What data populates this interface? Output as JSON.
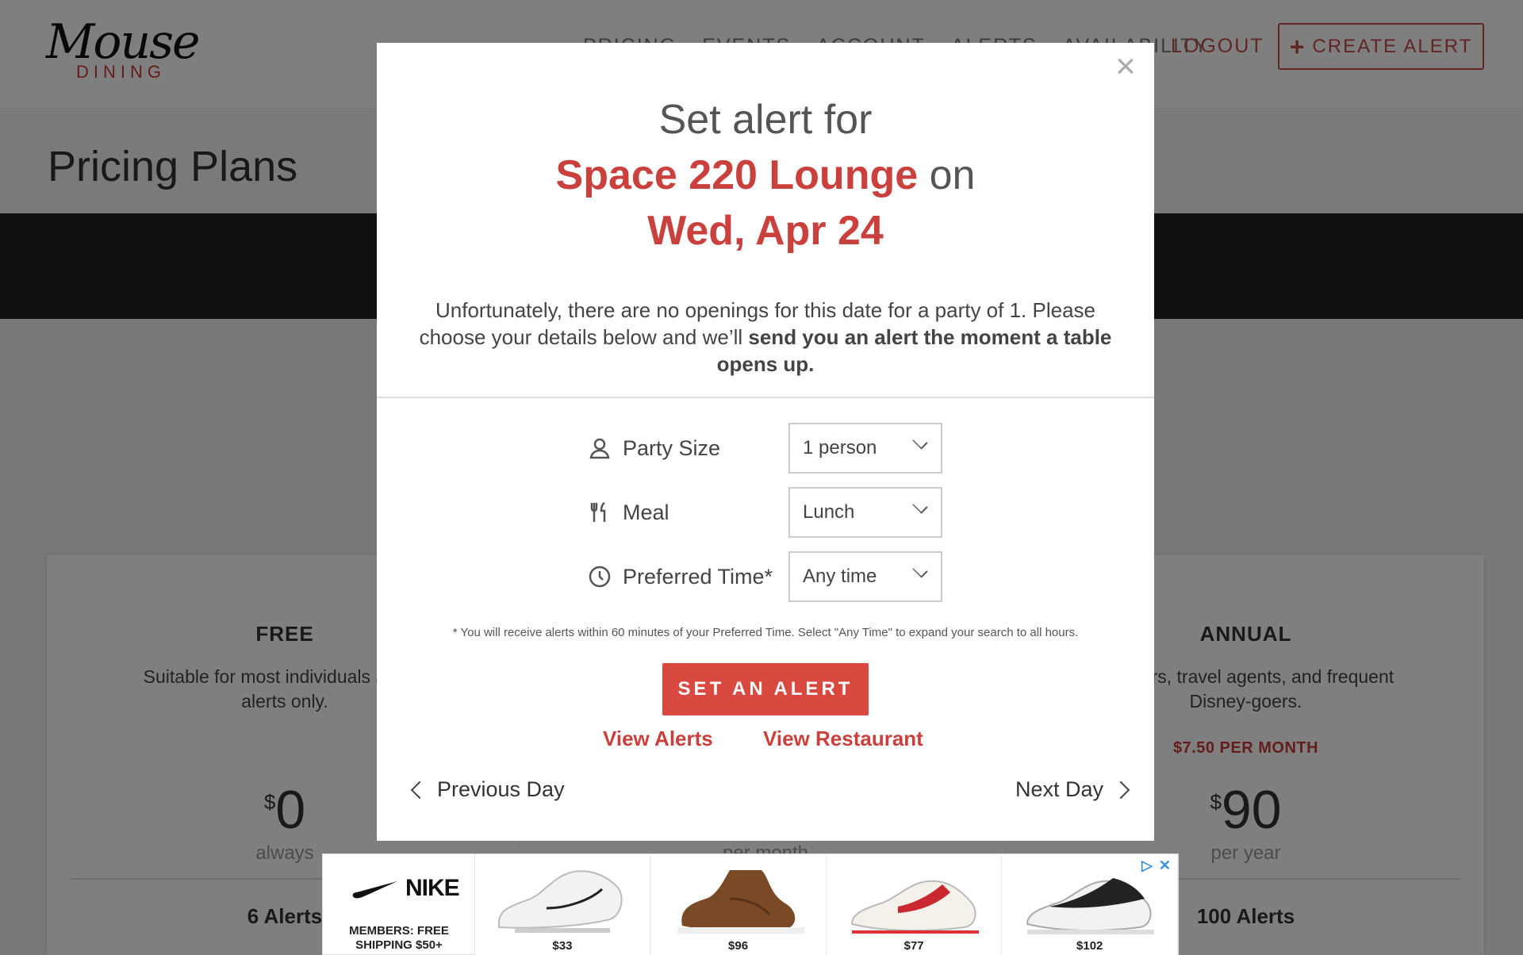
{
  "header": {
    "logo_script": "Mouse",
    "logo_sub": "DINING",
    "nav": [
      "PRICING",
      "EVENTS",
      "ACCOUNT",
      "ALERTS",
      "AVAILABILITY"
    ],
    "logout": "LOGOUT",
    "create_alert": "CREATE ALERT"
  },
  "page": {
    "title": "Pricing Plans"
  },
  "plans": {
    "free": {
      "name": "FREE",
      "desc_line1": "Suitable for most individuals and fa",
      "desc_line2": "alerts only.",
      "currency": "$",
      "price": "0",
      "period": "always",
      "alerts": "6 Alerts"
    },
    "annual": {
      "name": "ANNUAL",
      "desc_line1": "sholders, travel agents, and frequent",
      "desc_line2": "Disney-goers.",
      "monthly": "$7.50 PER MONTH",
      "currency": "$",
      "price": "90",
      "period": "per year",
      "alerts": "100 Alerts"
    },
    "middle": {
      "period": "per month"
    }
  },
  "modal": {
    "title_line1": "Set alert for",
    "restaurant": "Space 220 Lounge",
    "on_word": "on",
    "date": "Wed, Apr 24",
    "msg_plain": "Unfortunately, there are no openings for this date for a party of 1. Please choose your details below and we’ll ",
    "msg_bold": "send you an alert the moment a table opens up.",
    "fields": {
      "party_size": {
        "label": "Party Size",
        "value": "1 person"
      },
      "meal": {
        "label": "Meal",
        "value": "Lunch"
      },
      "preferred_time": {
        "label": "Preferred Time*",
        "value": "Any time"
      }
    },
    "footnote": "* You will receive alerts within 60 minutes of your Preferred Time. Select \"Any Time\" to expand your search to all hours.",
    "set_alert": "SET AN ALERT",
    "view_alerts": "View Alerts",
    "view_restaurant": "View Restaurant",
    "previous_day": "Previous Day",
    "next_day": "Next Day",
    "close": "×"
  },
  "ad": {
    "brand": "NIKE",
    "promo_line1": "MEMBERS: FREE",
    "promo_line2": "SHIPPING $50+",
    "items": [
      {
        "price": "$33"
      },
      {
        "price": "$96"
      },
      {
        "price": "$77"
      },
      {
        "price": "$102"
      }
    ]
  },
  "colors": {
    "accent_red": "#c9403c",
    "button_red": "#d9493f",
    "dark_band": "#222222"
  }
}
